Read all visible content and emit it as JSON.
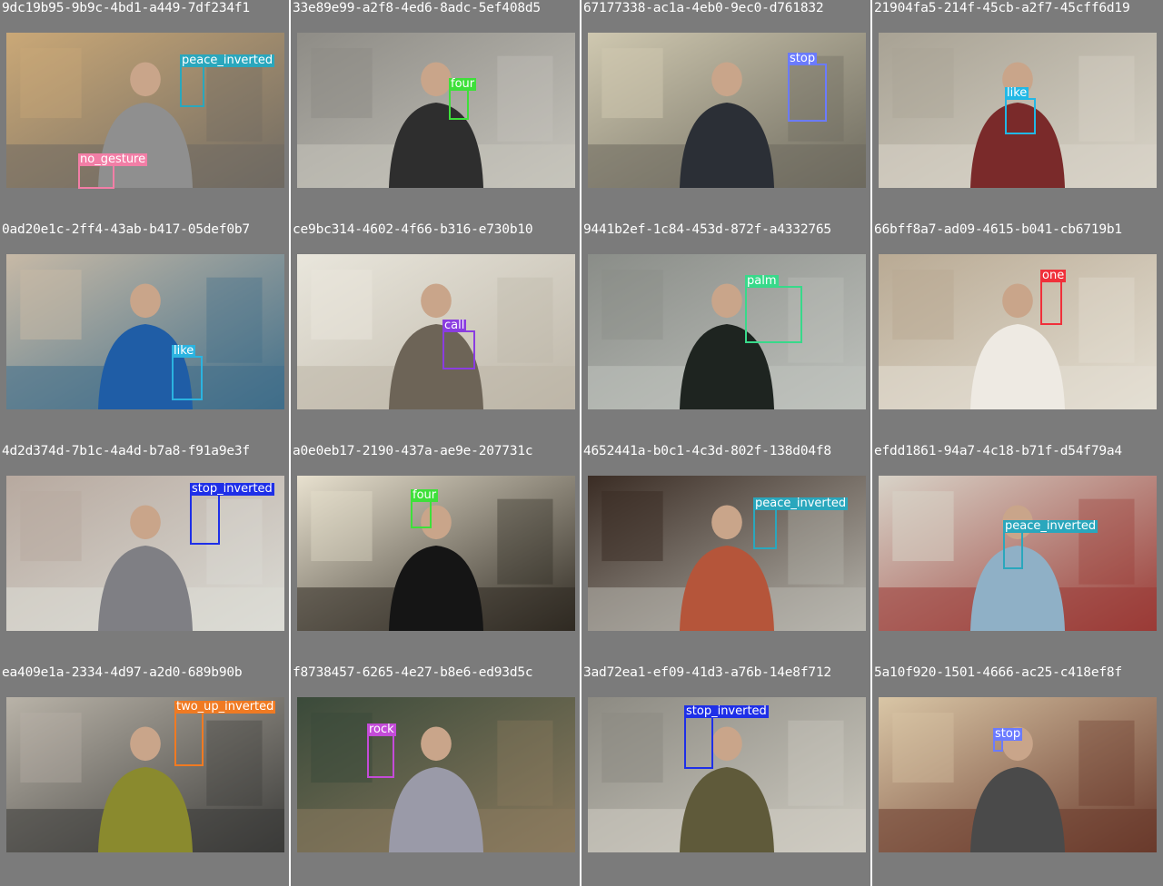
{
  "panels": [
    {
      "title": "9dc19b95-9b9c-4bd1-a449-7df234f1",
      "scene": "#6f6a62",
      "scene2": "#caa877",
      "person": "#8f8f8f",
      "boxes": [
        {
          "label": "peace_inverted",
          "color": "#2aa7bd"
        },
        {
          "label": "no_gesture",
          "color": "#f27ea6"
        }
      ]
    },
    {
      "title": "33e89e99-a2f8-4ed6-8adc-5ef408d5",
      "scene": "#c6c4bc",
      "scene2": "#8e8c86",
      "person": "#2e2e2e",
      "boxes": [
        {
          "label": "four",
          "color": "#3ee03a"
        }
      ]
    },
    {
      "title": "67177338-ac1a-4eb0-9ec0-d761832",
      "scene": "#6d6a5e",
      "scene2": "#cfc8b0",
      "person": "#2b2f36",
      "boxes": [
        {
          "label": "stop",
          "color": "#6b7bff"
        }
      ]
    },
    {
      "title": "21904fa5-214f-45cb-a2f7-45cff6d19",
      "scene": "#d9d4c8",
      "scene2": "#a8a294",
      "person": "#7a2a2a",
      "boxes": [
        {
          "label": "like",
          "color": "#21b8e6"
        }
      ]
    },
    {
      "title": "0ad20e1c-2ff4-43ab-b417-05def0b7",
      "scene": "#3f6e8a",
      "scene2": "#c7b9a6",
      "person": "#1f5da6",
      "boxes": [
        {
          "label": "like",
          "color": "#2bb3e0"
        }
      ]
    },
    {
      "title": "ce9bc314-4602-4f66-b316-e730b10",
      "scene": "#bdb6a8",
      "scene2": "#e9e6dc",
      "person": "#6d6457",
      "boxes": [
        {
          "label": "call",
          "color": "#8a3de0"
        }
      ]
    },
    {
      "title": "9441b2ef-1c84-453d-872f-a4332765",
      "scene": "#bfc2bd",
      "scene2": "#8a8d88",
      "person": "#1e2420",
      "boxes": [
        {
          "label": "palm",
          "color": "#38d98a"
        }
      ]
    },
    {
      "title": "66bff8a7-ad09-4615-b041-cb6719b1",
      "scene": "#e4dfd3",
      "scene2": "#b9aa94",
      "person": "#eeeae3",
      "boxes": [
        {
          "label": "one",
          "color": "#f0303a"
        }
      ]
    },
    {
      "title": "4d2d374d-7b1c-4a4d-b7a8-f91a9e3f",
      "scene": "#dcdcd6",
      "scene2": "#b7a99f",
      "person": "#7f7f84",
      "boxes": [
        {
          "label": "stop_inverted",
          "color": "#1e2fe8"
        }
      ]
    },
    {
      "title": "a0e0eb17-2190-437a-ae9e-207731c",
      "scene": "#2f2a22",
      "scene2": "#e8e1cf",
      "person": "#151515",
      "boxes": [
        {
          "label": "four",
          "color": "#3ee03a"
        }
      ]
    },
    {
      "title": "4652441a-b0c1-4c3d-802f-138d04f8",
      "scene": "#b8b6ae",
      "scene2": "#3a2c24",
      "person": "#b5553a",
      "boxes": [
        {
          "label": "peace_inverted",
          "color": "#2aa7bd"
        }
      ]
    },
    {
      "title": "efdd1861-94a7-4c18-b71f-d54f79a4",
      "scene": "#9a3b36",
      "scene2": "#d8d3c8",
      "person": "#8fb0c6",
      "boxes": [
        {
          "label": "peace_inverted",
          "color": "#2aa7bd"
        }
      ]
    },
    {
      "title": "ea409e1a-2334-4d97-a2d0-689b90b",
      "scene": "#3b3b39",
      "scene2": "#b9b3a8",
      "person": "#8a8a2e",
      "boxes": [
        {
          "label": "two_up_inverted",
          "color": "#f07a22"
        }
      ]
    },
    {
      "title": "f8738457-6265-4e27-b8e6-ed93d5c",
      "scene": "#8b7a5e",
      "scene2": "#3a4a3a",
      "person": "#9a9aa8",
      "boxes": [
        {
          "label": "rock",
          "color": "#c44bd8"
        }
      ]
    },
    {
      "title": "3ad72ea1-ef09-41d3-a76b-14e8f712",
      "scene": "#cfccc2",
      "scene2": "#8c8a82",
      "person": "#5f5a3a",
      "boxes": [
        {
          "label": "stop_inverted",
          "color": "#1e2fe8"
        }
      ]
    },
    {
      "title": "5a10f920-1501-4666-ac25-c418ef8f",
      "scene": "#6a3a2c",
      "scene2": "#d9c6a6",
      "person": "#4a4a4a",
      "boxes": [
        {
          "label": "stop",
          "color": "#6b7bff"
        }
      ]
    }
  ]
}
